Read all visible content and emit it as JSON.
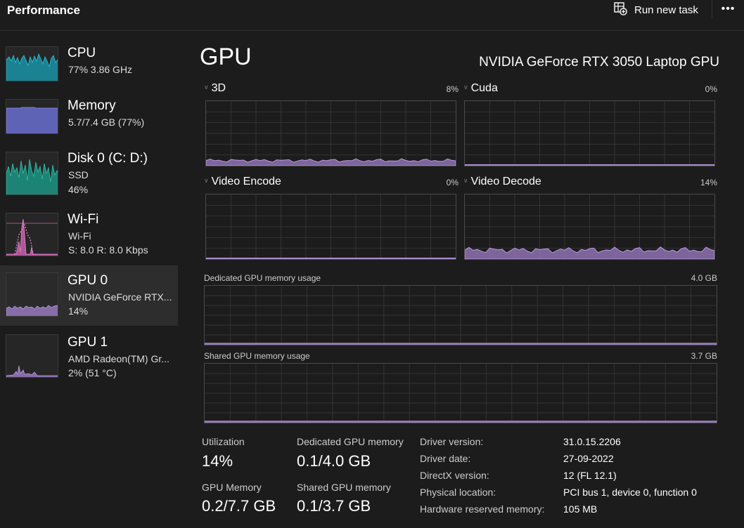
{
  "app": {
    "title": "Performance",
    "run_new_task": "Run new task",
    "more_icon": "more-icon",
    "run_task_icon": "run-task-icon"
  },
  "colors": {
    "gpu_purple": "#9d7ec7",
    "cpu_teal": "#17a2b8",
    "disk_teal": "#1c9c8a",
    "mem_blue": "#6a6fd0",
    "wifi_pink": "#d264b6"
  },
  "sidebar": {
    "items": [
      {
        "name": "CPU",
        "line1": "77%  3.86 GHz",
        "line2": ""
      },
      {
        "name": "Memory",
        "line1": "5.7/7.4 GB (77%)",
        "line2": ""
      },
      {
        "name": "Disk 0 (C: D:)",
        "line1": "SSD",
        "line2": "46%"
      },
      {
        "name": "Wi-Fi",
        "line1": "Wi-Fi",
        "line2": "S: 8.0  R: 8.0 Kbps"
      },
      {
        "name": "GPU 0",
        "line1": "NVIDIA GeForce RTX...",
        "line2": "14%"
      },
      {
        "name": "GPU 1",
        "line1": "AMD Radeon(TM) Gr...",
        "line2": "2%  (51 °C)"
      }
    ]
  },
  "main": {
    "title": "GPU",
    "gpu_name": "NVIDIA GeForce RTX 3050 Laptop GPU",
    "engines": [
      {
        "label": "3D",
        "percent": "8%",
        "level": 0.08
      },
      {
        "label": "Cuda",
        "percent": "0%",
        "level": 0.0
      },
      {
        "label": "Video Encode",
        "percent": "0%",
        "level": 0.0
      },
      {
        "label": "Video Decode",
        "percent": "14%",
        "level": 0.14
      }
    ],
    "dedicated": {
      "label": "Dedicated GPU memory usage",
      "max": "4.0 GB",
      "level": 0.025
    },
    "shared": {
      "label": "Shared GPU memory usage",
      "max": "3.7 GB",
      "level": 0.027
    }
  },
  "stats": {
    "utilization_label": "Utilization",
    "utilization_value": "14%",
    "dedicated_label": "Dedicated GPU memory",
    "dedicated_value": "0.1/4.0 GB",
    "gpu_memory_label": "GPU Memory",
    "gpu_memory_value": "0.2/7.7 GB",
    "shared_label": "Shared GPU memory",
    "shared_value": "0.1/3.7 GB"
  },
  "info": [
    {
      "key": "Driver version:",
      "value": "31.0.15.2206"
    },
    {
      "key": "Driver date:",
      "value": "27-09-2022"
    },
    {
      "key": "DirectX version:",
      "value": "12 (FL 12.1)"
    },
    {
      "key": "Physical location:",
      "value": "PCI bus 1, device 0, function 0"
    },
    {
      "key": "Hardware reserved memory:",
      "value": "105 MB"
    }
  ]
}
